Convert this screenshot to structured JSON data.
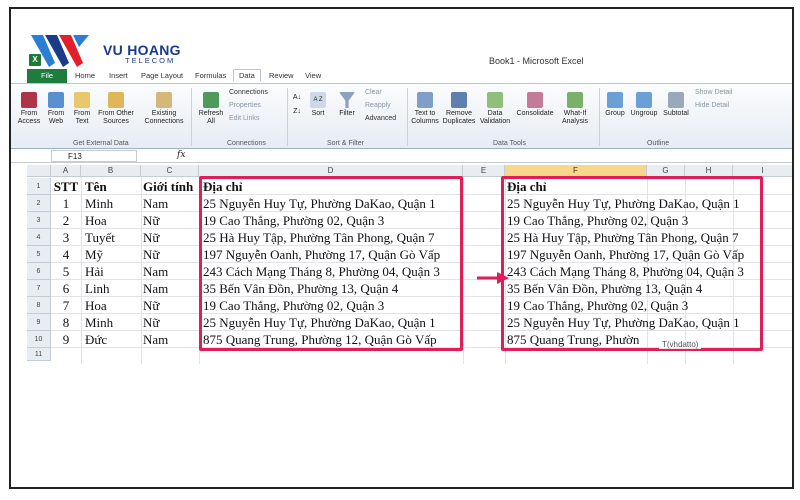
{
  "logo": {
    "brand": "VU HOANG",
    "sub": "TELECOM"
  },
  "window": {
    "title": "Book1 - Microsoft Excel",
    "app_icon": "X"
  },
  "tabs": [
    "File",
    "Home",
    "Insert",
    "Page Layout",
    "Formulas",
    "Data",
    "Review",
    "View"
  ],
  "ribbon": {
    "from_access": "From\nAccess",
    "from_web": "From\nWeb",
    "from_text": "From\nText",
    "from_other": "From Other\nSources",
    "existing": "Existing\nConnections",
    "refresh": "Refresh\nAll",
    "connections": "Connections",
    "properties": "Properties",
    "edit_links": "Edit Links",
    "sort_az": "A Z",
    "sort": "Sort",
    "filter": "Filter",
    "clear": "Clear",
    "reapply": "Reapply",
    "advanced": "Advanced",
    "text_to_columns": "Text to\nColumns",
    "remove_duplicates": "Remove\nDuplicates",
    "data_validation": "Data\nValidation",
    "consolidate": "Consolidate",
    "what_if": "What-If\nAnalysis",
    "group": "Group",
    "ungroup": "Ungroup",
    "subtotal": "Subtotal",
    "show_detail": "Show Detail",
    "hide_detail": "Hide Detail",
    "groups": [
      "Get External Data",
      "Connections",
      "Sort & Filter",
      "Data Tools",
      "Outline"
    ]
  },
  "formula_bar": {
    "name_box": "F13",
    "fx": "fx"
  },
  "columns": [
    "A",
    "B",
    "C",
    "D",
    "E",
    "F",
    "G",
    "H",
    "I"
  ],
  "rows": [
    "1",
    "2",
    "3",
    "4",
    "5",
    "6",
    "7",
    "8",
    "9",
    "10",
    "11"
  ],
  "table": {
    "headers": {
      "stt": "STT",
      "ten": "Tên",
      "gioi_tinh": "Giới tính",
      "dia_chi": "Địa chỉ"
    },
    "rows": [
      {
        "stt": "1",
        "ten": "Minh",
        "gioi": "Nam",
        "dia_chi": "25 Nguyễn Huy Tự, Phường DaKao, Quận 1"
      },
      {
        "stt": "2",
        "ten": "Hoa",
        "gioi": "Nữ",
        "dia_chi": "19 Cao Thắng, Phường 02, Quận 3"
      },
      {
        "stt": "3",
        "ten": "Tuyết",
        "gioi": "Nữ",
        "dia_chi": "25 Hà Huy Tập, Phường Tân Phong, Quận 7"
      },
      {
        "stt": "4",
        "ten": "Mỹ",
        "gioi": "Nữ",
        "dia_chi": "197 Nguyễn Oanh, Phường 17, Quận Gò Vấp"
      },
      {
        "stt": "5",
        "ten": "Hải",
        "gioi": "Nam",
        "dia_chi": "243 Cách Mạng Tháng 8, Phường 04, Quận 3"
      },
      {
        "stt": "6",
        "ten": "Linh",
        "gioi": "Nam",
        "dia_chi": "35 Bến Vân Đồn, Phường 13, Quận 4"
      },
      {
        "stt": "7",
        "ten": "Hoa",
        "gioi": "Nữ",
        "dia_chi": "19 Cao Thắng, Phường 02, Quận 3"
      },
      {
        "stt": "8",
        "ten": "Minh",
        "gioi": "Nữ",
        "dia_chi": "25 Nguyễn Huy Tự, Phường DaKao, Quận 1"
      },
      {
        "stt": "9",
        "ten": "Đức",
        "gioi": "Nam",
        "dia_chi": "875 Quang Trung, Phường 12, Quận Gò Vấp"
      }
    ]
  },
  "result": {
    "header": "Địa chỉ",
    "rows": [
      "25 Nguyễn Huy Tự, Phường DaKao, Quận 1",
      "19 Cao Thắng, Phường 02, Quận 3",
      "25 Hà Huy Tập, Phường Tân Phong, Quận 7",
      "197 Nguyễn Oanh, Phường 17, Quận Gò Vấp",
      "243 Cách Mạng Tháng 8, Phường 04, Quận 3",
      "35 Bến Vân Đồn, Phường 13, Quận 4",
      "19 Cao Thắng, Phường 02, Quận 3",
      "25 Nguyễn Huy Tự, Phường DaKao, Quận 1",
      "875 Quang Trung, Phườn"
    ]
  },
  "watermark": "T(vhdatto)",
  "colors": {
    "highlight": "#e01e5a",
    "excel_green": "#1e7c3c",
    "brand_blue": "#1a3a8a"
  }
}
